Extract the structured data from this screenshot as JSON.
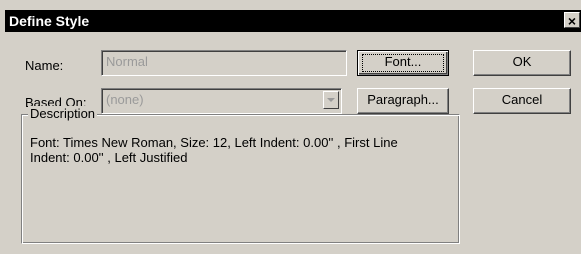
{
  "window": {
    "title": "Define Style",
    "close_glyph": "×"
  },
  "form": {
    "name_label": "Name:",
    "name_value": "Normal",
    "based_on_label": "Based On:",
    "based_on_value": "(none)"
  },
  "buttons": {
    "font": "Font...",
    "paragraph": "Paragraph...",
    "ok": "OK",
    "cancel": "Cancel"
  },
  "description": {
    "title": "Description",
    "text": "Font: Times New Roman, Size: 12, Left Indent: 0.00'' , First Line Indent: 0.00'' , Left Justified"
  },
  "icons": {
    "close": "close-icon",
    "dropdown": "chevron-down-icon"
  },
  "colors": {
    "dialog_bg": "#d4d0c8",
    "titlebar_bg": "#000000",
    "titlebar_text": "#ffffff",
    "disabled_text": "#9a9a9a"
  }
}
